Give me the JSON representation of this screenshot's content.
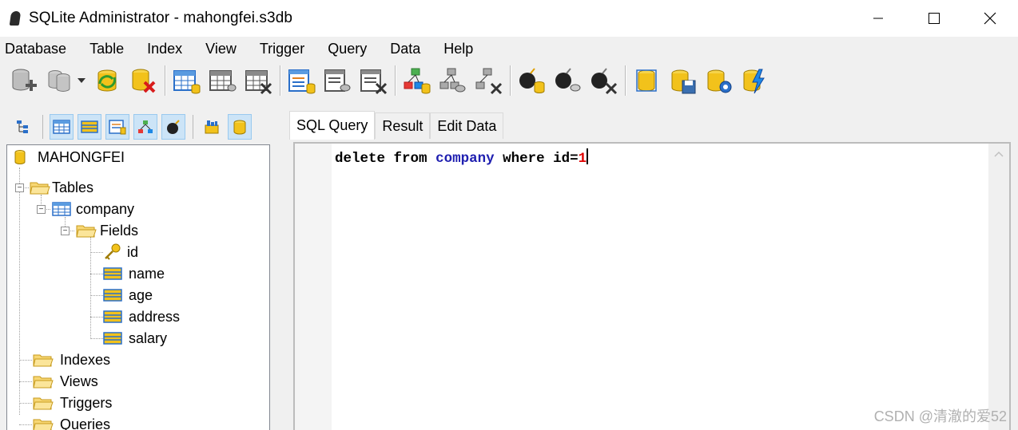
{
  "window": {
    "title": "SQLite Administrator - mahongfei.s3db",
    "app_icon": "sqlite-feather-icon"
  },
  "menu": [
    "Database",
    "Table",
    "Index",
    "View",
    "Trigger",
    "Query",
    "Data",
    "Help"
  ],
  "toolbar_icons": [
    "add-database-icon",
    "open-database-icon",
    "refresh-database-icon",
    "delete-database-icon",
    "table-icon",
    "edit-table-icon",
    "delete-table-icon",
    "index-icon",
    "edit-index-icon",
    "delete-index-icon",
    "view-icon",
    "edit-view-icon",
    "delete-view-icon",
    "trigger-icon",
    "edit-trigger-icon",
    "delete-trigger-icon",
    "database-icon",
    "save-database-icon",
    "database-settings-icon",
    "compact-database-icon"
  ],
  "left_toolbar_icons": [
    "tree-view-icon",
    "tables-icon",
    "fields-icon",
    "indexes-icon",
    "views-icon",
    "triggers-icon",
    "queries-icon",
    "database-info-icon"
  ],
  "tree": {
    "database": "MAHONGFEI",
    "tables_label": "Tables",
    "table_name": "company",
    "fields_label": "Fields",
    "fields": [
      "id",
      "name",
      "age",
      "address",
      "salary"
    ],
    "indexes_label": "Indexes",
    "views_label": "Views",
    "triggers_label": "Triggers",
    "queries_label": "Queries"
  },
  "tabs": [
    "SQL Query",
    "Result",
    "Edit Data"
  ],
  "active_tab": "SQL Query",
  "editor": {
    "tokens": [
      "delete",
      "from",
      "company",
      "where",
      "id=",
      "1"
    ]
  },
  "watermark": "CSDN @清澈的爱52",
  "colors": {
    "keyword": "#000000",
    "identifier": "#1f1fb0",
    "number": "#e00000",
    "db_yellow": "#f2c21b",
    "table_blue": "#2a6fc9"
  }
}
